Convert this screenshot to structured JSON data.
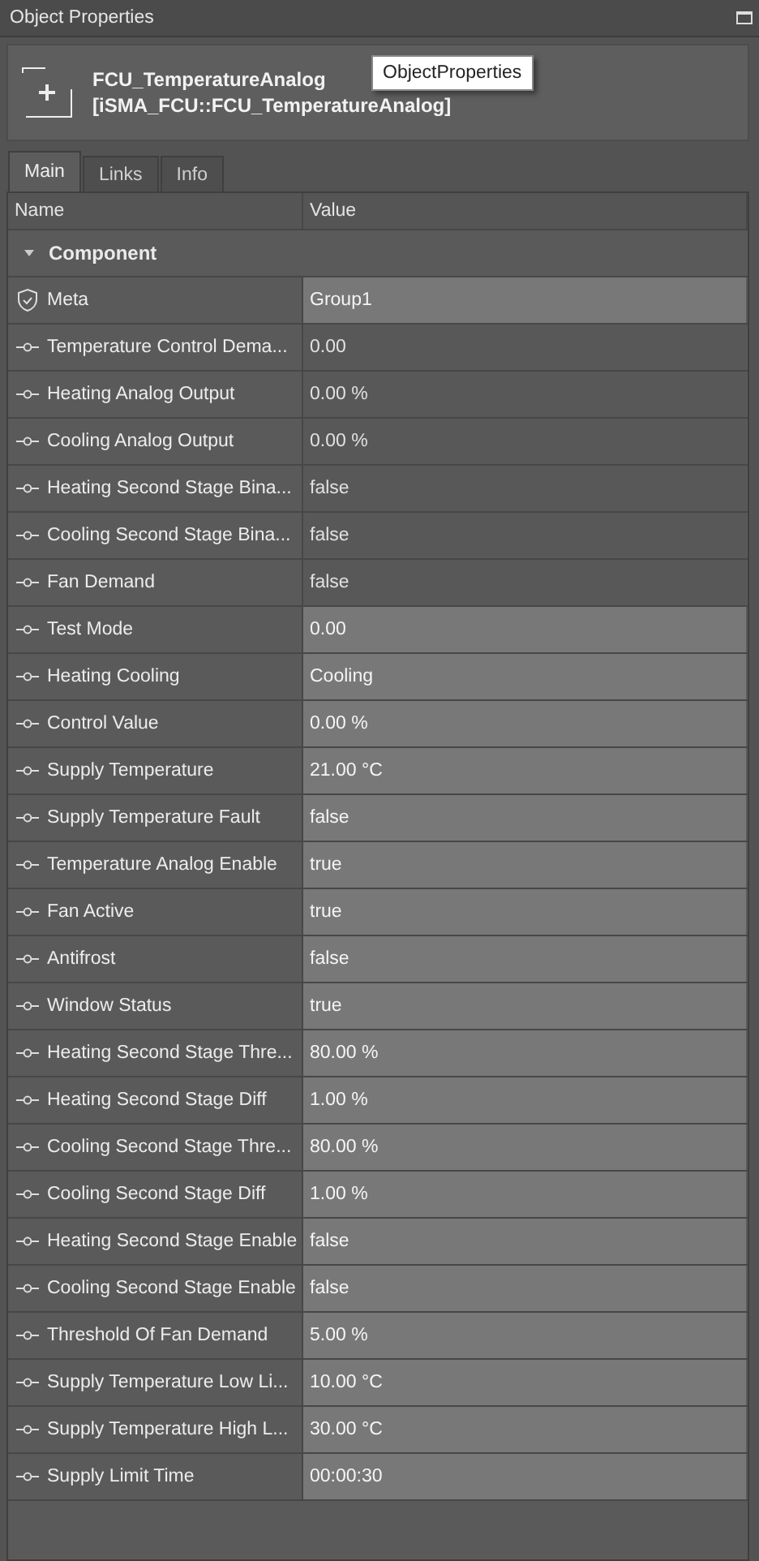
{
  "panel": {
    "title": "Object Properties"
  },
  "header": {
    "name": "FCU_TemperatureAnalog",
    "type": "[iSMA_FCU::FCU_TemperatureAnalog]",
    "tooltip": "ObjectProperties"
  },
  "tabs": [
    {
      "label": "Main",
      "selected": true
    },
    {
      "label": "Links",
      "selected": false
    },
    {
      "label": "Info",
      "selected": false
    }
  ],
  "table": {
    "columns": [
      "Name",
      "Value"
    ],
    "group": {
      "label": "Component",
      "expanded": true
    },
    "rows": [
      {
        "kind": "meta",
        "name": "Meta",
        "value": "Group1",
        "editable": true
      },
      {
        "kind": "slot",
        "name": "Temperature Control Dema...",
        "value": "0.00",
        "editable": false
      },
      {
        "kind": "slot",
        "name": "Heating Analog Output",
        "value": "0.00 %",
        "editable": false
      },
      {
        "kind": "slot",
        "name": "Cooling Analog Output",
        "value": "0.00 %",
        "editable": false
      },
      {
        "kind": "slot",
        "name": "Heating Second Stage Bina...",
        "value": "false",
        "editable": false
      },
      {
        "kind": "slot",
        "name": "Cooling Second Stage Bina...",
        "value": "false",
        "editable": false
      },
      {
        "kind": "slot",
        "name": "Fan Demand",
        "value": "false",
        "editable": false
      },
      {
        "kind": "slot",
        "name": "Test Mode",
        "value": "0.00",
        "editable": true
      },
      {
        "kind": "slot",
        "name": "Heating Cooling",
        "value": "Cooling",
        "editable": true
      },
      {
        "kind": "slot",
        "name": "Control Value",
        "value": "0.00 %",
        "editable": true
      },
      {
        "kind": "slot",
        "name": "Supply Temperature",
        "value": "21.00 °C",
        "editable": true
      },
      {
        "kind": "slot",
        "name": "Supply Temperature Fault",
        "value": "false",
        "editable": true
      },
      {
        "kind": "slot",
        "name": "Temperature Analog Enable",
        "value": "true",
        "editable": true
      },
      {
        "kind": "slot",
        "name": "Fan Active",
        "value": "true",
        "editable": true
      },
      {
        "kind": "slot",
        "name": "Antifrost",
        "value": "false",
        "editable": true
      },
      {
        "kind": "slot",
        "name": "Window Status",
        "value": "true",
        "editable": true
      },
      {
        "kind": "slot",
        "name": "Heating Second Stage Thre...",
        "value": "80.00 %",
        "editable": true
      },
      {
        "kind": "slot",
        "name": "Heating Second Stage Diff",
        "value": "1.00 %",
        "editable": true
      },
      {
        "kind": "slot",
        "name": "Cooling Second Stage Thre...",
        "value": "80.00 %",
        "editable": true
      },
      {
        "kind": "slot",
        "name": "Cooling Second Stage Diff",
        "value": "1.00 %",
        "editable": true
      },
      {
        "kind": "slot",
        "name": "Heating Second Stage Enable",
        "value": "false",
        "editable": true
      },
      {
        "kind": "slot",
        "name": "Cooling Second Stage Enable",
        "value": "false",
        "editable": true
      },
      {
        "kind": "slot",
        "name": "Threshold Of Fan Demand",
        "value": "5.00 %",
        "editable": true
      },
      {
        "kind": "slot",
        "name": "Supply Temperature Low Li...",
        "value": "10.00 °C",
        "editable": true
      },
      {
        "kind": "slot",
        "name": "Supply Temperature High L...",
        "value": "30.00 °C",
        "editable": true
      },
      {
        "kind": "slot",
        "name": "Supply Limit Time",
        "value": "00:00:30",
        "editable": true
      }
    ]
  }
}
